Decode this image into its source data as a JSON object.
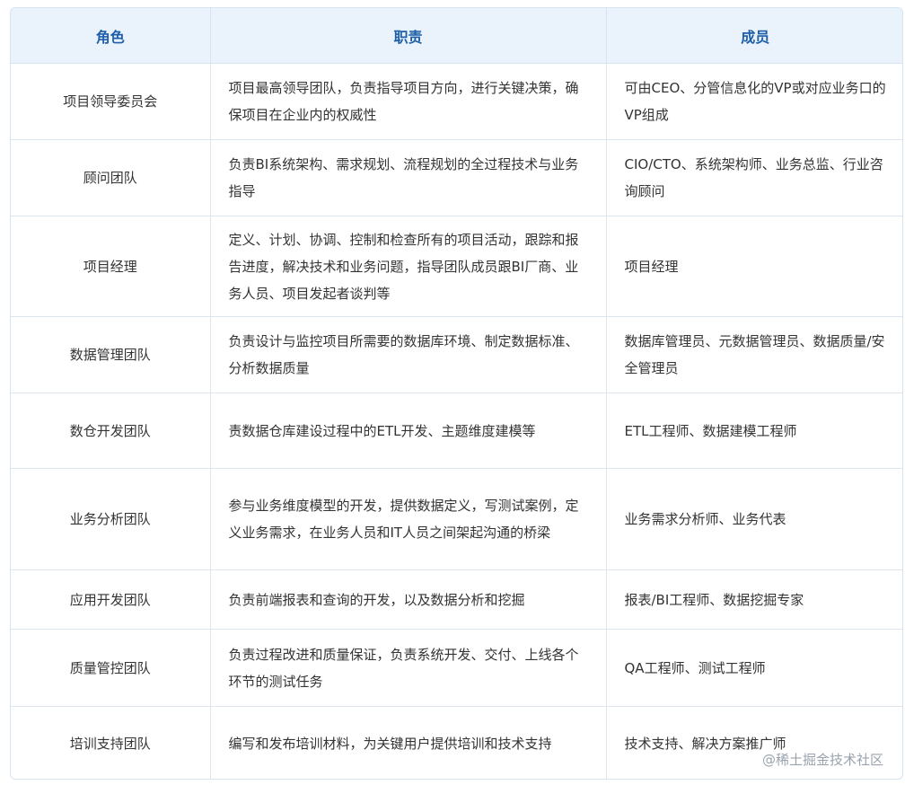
{
  "header": {
    "role": "角色",
    "duty": "职责",
    "members": "成员"
  },
  "rows": [
    {
      "role": "项目领导委员会",
      "duty": "项目最高领导团队，负责指导项目方向，进行关键决策，确保项目在企业内的权威性",
      "members": "可由CEO、分管信息化的VP或对应业务口的VP组成"
    },
    {
      "role": "顾问团队",
      "duty": "负责BI系统架构、需求规划、流程规划的全过程技术与业务指导",
      "members": "CIO/CTO、系统架构师、业务总监、行业咨询顾问"
    },
    {
      "role": "项目经理",
      "duty": "定义、计划、协调、控制和检查所有的项目活动，跟踪和报告进度，解决技术和业务问题，指导团队成员跟BI厂商、业务人员、项目发起者谈判等",
      "members": "项目经理"
    },
    {
      "role": "数据管理团队",
      "duty": "负责设计与监控项目所需要的数据库环境、制定数据标准、分析数据质量",
      "members": "数据库管理员、元数据管理员、数据质量/安全管理员"
    },
    {
      "role": "数仓开发团队",
      "duty": "责数据仓库建设过程中的ETL开发、主题维度建模等",
      "members": "ETL工程师、数据建模工程师"
    },
    {
      "role": "业务分析团队",
      "duty": "参与业务维度模型的开发，提供数据定义，写测试案例，定义业务需求，在业务人员和IT人员之间架起沟通的桥梁",
      "members": "业务需求分析师、业务代表"
    },
    {
      "role": "应用开发团队",
      "duty": "负责前端报表和查询的开发，以及数据分析和挖掘",
      "members": "报表/BI工程师、数据挖掘专家"
    },
    {
      "role": "质量管控团队",
      "duty": "负责过程改进和质量保证，负责系统开发、交付、上线各个环节的测试任务",
      "members": "QA工程师、测试工程师"
    },
    {
      "role": "培训支持团队",
      "duty": "编写和发布培训材料，为关键用户提供培训和技术支持",
      "members": "技术支持、解决方案推广师"
    }
  ],
  "watermark": "@稀土掘金技术社区"
}
